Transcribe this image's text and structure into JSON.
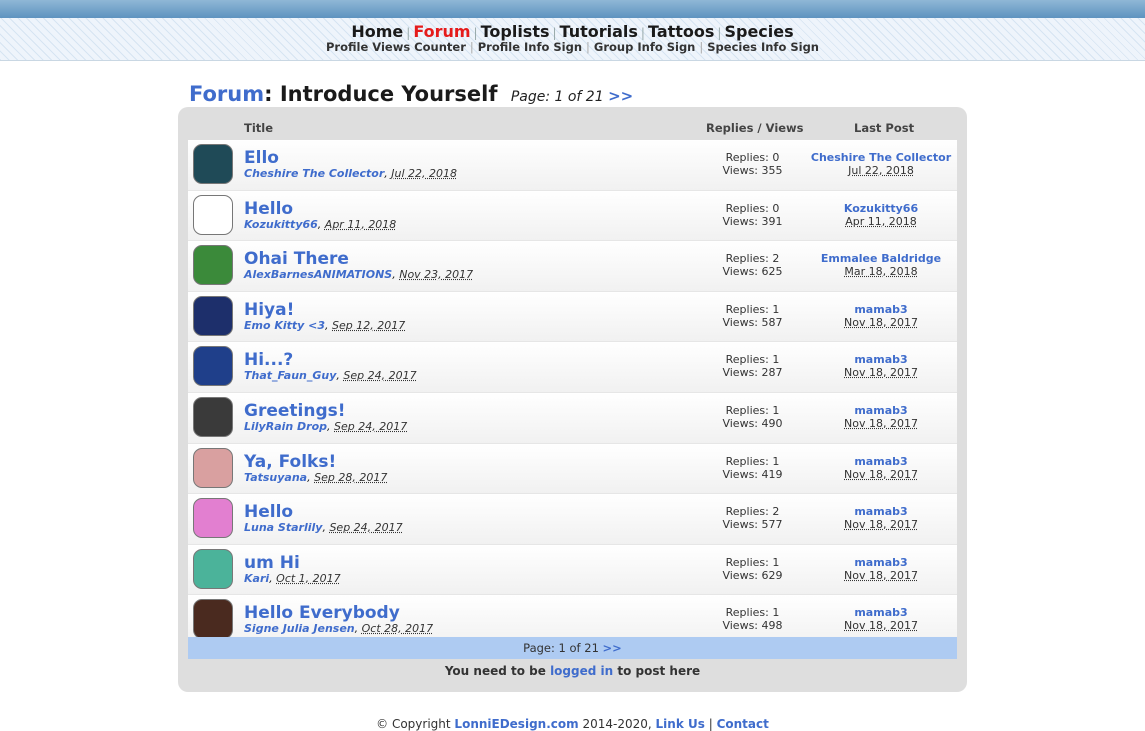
{
  "nav": {
    "main": [
      {
        "label": "Home",
        "active": false
      },
      {
        "label": "Forum",
        "active": true
      },
      {
        "label": "Toplists",
        "active": false
      },
      {
        "label": "Tutorials",
        "active": false
      },
      {
        "label": "Tattoos",
        "active": false
      },
      {
        "label": "Species",
        "active": false
      }
    ],
    "sub": [
      "Profile Views Counter",
      "Profile Info Sign",
      "Group Info Sign",
      "Species Info Sign"
    ],
    "separator": "|"
  },
  "page": {
    "forum_link": "Forum",
    "title_suffix": ": Introduce Yourself",
    "page_info": "Page: 1 of 21",
    "next": ">>"
  },
  "table": {
    "headers": {
      "title": "Title",
      "replies_views": "Replies / Views",
      "last_post": "Last Post"
    },
    "threads": [
      {
        "title": "Ello",
        "author": "Cheshire The Collector",
        "date": "Jul 22, 2018",
        "replies": "Replies: 0",
        "views": "Views: 355",
        "last_user": "Cheshire The Collector",
        "last_date": "Jul 22, 2018",
        "avatar": "cheshire-cat-avatar",
        "avatar_color": "#1f4a57"
      },
      {
        "title": "Hello",
        "author": "Kozukitty66",
        "date": "Apr 11, 2018",
        "replies": "Replies: 0",
        "views": "Views: 391",
        "last_user": "Kozukitty66",
        "last_date": "Apr 11, 2018",
        "avatar": "blank-avatar",
        "avatar_color": "#ffffff"
      },
      {
        "title": "Ohai There",
        "author": "AlexBarnesANIMATIONS",
        "date": "Nov 23, 2017",
        "replies": "Replies: 2",
        "views": "Views: 625",
        "last_user": "Emmalee Baldridge",
        "last_date": "Mar 18, 2018",
        "avatar": "green-hair-character-avatar",
        "avatar_color": "#3b8a3a"
      },
      {
        "title": "Hiya!",
        "author": "Emo Kitty <3",
        "date": "Sep 12, 2017",
        "replies": "Replies: 1",
        "views": "Views: 587",
        "last_user": "mamab3",
        "last_date": "Nov 18, 2017",
        "avatar": "dark-portrait-avatar",
        "avatar_color": "#1d2f6b"
      },
      {
        "title": "Hi...?",
        "author": "That_Faun_Guy",
        "date": "Sep 24, 2017",
        "replies": "Replies: 1",
        "views": "Views: 287",
        "last_user": "mamab3",
        "last_date": "Nov 18, 2017",
        "avatar": "blue-faun-avatar",
        "avatar_color": "#1f3f8a"
      },
      {
        "title": "Greetings!",
        "author": "LilyRain Drop",
        "date": "Sep 24, 2017",
        "replies": "Replies: 1",
        "views": "Views: 490",
        "last_user": "mamab3",
        "last_date": "Nov 18, 2017",
        "avatar": "grayscale-portrait-avatar",
        "avatar_color": "#3a3a3a"
      },
      {
        "title": "Ya, Folks!",
        "author": "Tatsuyana",
        "date": "Sep 28, 2017",
        "replies": "Replies: 1",
        "views": "Views: 419",
        "last_user": "mamab3",
        "last_date": "Nov 18, 2017",
        "avatar": "person-portrait-avatar",
        "avatar_color": "#d9a0a0"
      },
      {
        "title": "Hello",
        "author": "Luna Starlily",
        "date": "Sep 24, 2017",
        "replies": "Replies: 2",
        "views": "Views: 577",
        "last_user": "mamab3",
        "last_date": "Nov 18, 2017",
        "avatar": "pink-creature-avatar",
        "avatar_color": "#e27fd0"
      },
      {
        "title": "um Hi",
        "author": "Kari",
        "date": "Oct 1, 2017",
        "replies": "Replies: 1",
        "views": "Views: 629",
        "last_user": "mamab3",
        "last_date": "Nov 18, 2017",
        "avatar": "teal-character-avatar",
        "avatar_color": "#4bb39a"
      },
      {
        "title": "Hello Everybody",
        "author": "Signe Julia Jensen",
        "date": "Oct 28, 2017",
        "replies": "Replies: 1",
        "views": "Views: 498",
        "last_user": "mamab3",
        "last_date": "Nov 18, 2017",
        "avatar": "brown-portrait-avatar",
        "avatar_color": "#4a2a1f"
      }
    ]
  },
  "pager": {
    "text": "Page: 1 of 21",
    "next": ">>"
  },
  "login": {
    "prefix": "You need to be",
    "link": "logged in",
    "suffix": "to post here"
  },
  "footer": {
    "copyright": "© Copyright",
    "site": "LonniEDesign.com",
    "years": "2014-2020,",
    "link_us": "Link Us",
    "separator": "|",
    "contact": "Contact"
  },
  "colors": {
    "link": "#3f6ccc",
    "active_nav": "#e51b1b",
    "pager_bar": "#aecbf2",
    "panel": "#dedede"
  }
}
